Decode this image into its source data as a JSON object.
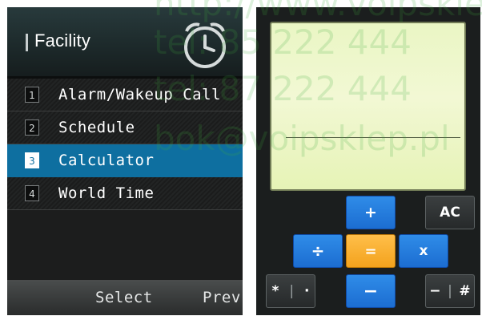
{
  "left_screen": {
    "title": "Facility",
    "clock_icon": "alarm-clock-icon",
    "menu": [
      {
        "num": "1",
        "label": "Alarm/Wakeup Call",
        "selected": false
      },
      {
        "num": "2",
        "label": "Schedule",
        "selected": false
      },
      {
        "num": "3",
        "label": "Calculator",
        "selected": true
      },
      {
        "num": "4",
        "label": "World Time",
        "selected": false
      }
    ],
    "softkeys": {
      "left": "Select",
      "right": "Prev"
    }
  },
  "calculator": {
    "display": "",
    "keys": {
      "plus": "+",
      "all_clear": "AC",
      "divide": "÷",
      "equals": "=",
      "multiply": "x",
      "star": "*",
      "dot": "·",
      "minus": "−",
      "minus_alt": "−",
      "hash": "#"
    }
  },
  "watermark": {
    "url": "http://www.voipsklep",
    "tel1": "tel: 85 222 444",
    "tel2": "tel: 87 222 444",
    "email": "bok@voipsklep.pl"
  },
  "colors": {
    "selected_row": "#0e6fa0",
    "lcd_background": "#eef7c8",
    "key_blue": "#2f8ce8",
    "key_orange": "#f3a21d",
    "key_dark": "#2b2f30"
  }
}
